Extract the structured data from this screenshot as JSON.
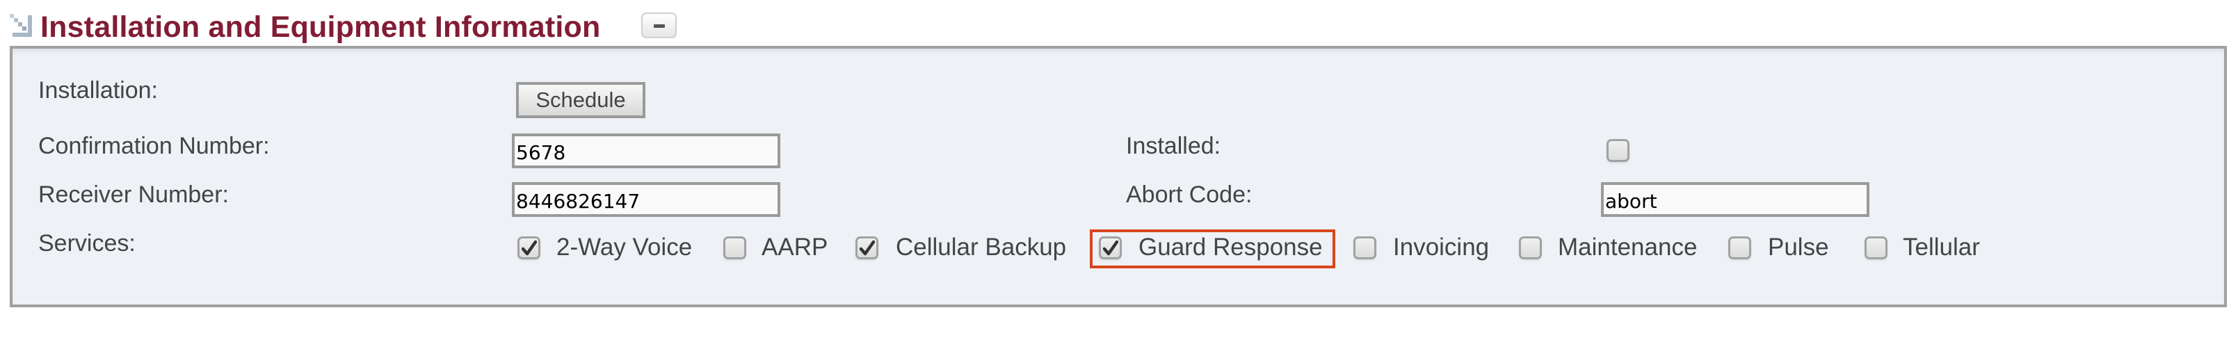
{
  "section": {
    "title": "Installation and Equipment Information",
    "icon": "expand-arrow-icon",
    "collapse_icon": "minus-icon",
    "title_color": "#821c34"
  },
  "form": {
    "installation": {
      "label": "Installation:",
      "button_label": "Schedule"
    },
    "confirmation_number": {
      "label": "Confirmation Number:",
      "value": "5678"
    },
    "receiver_number": {
      "label": "Receiver Number:",
      "value": "8446826147"
    },
    "installed": {
      "label": "Installed:",
      "checked": false
    },
    "abort_code": {
      "label": "Abort Code:",
      "value": "abort"
    },
    "services": {
      "label": "Services:",
      "items": [
        {
          "label": "2-Way Voice",
          "checked": true
        },
        {
          "label": "AARP",
          "checked": false
        },
        {
          "label": "Cellular Backup",
          "checked": true
        },
        {
          "label": "Guard Response",
          "checked": true,
          "highlighted": true
        },
        {
          "label": "Invoicing",
          "checked": false
        },
        {
          "label": "Maintenance",
          "checked": false
        },
        {
          "label": "Pulse",
          "checked": false
        },
        {
          "label": "Tellular",
          "checked": false
        }
      ]
    }
  },
  "colors": {
    "panel_bg": "#eef1f6",
    "highlight_border": "#d9461e"
  }
}
